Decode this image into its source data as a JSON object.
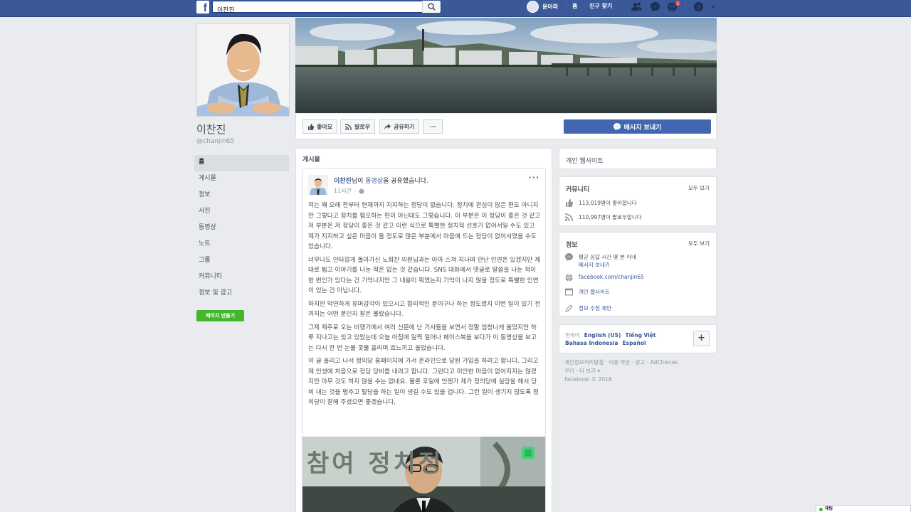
{
  "topbar": {
    "search_value": "이찬진",
    "user_name": "윤아라",
    "home": "홈",
    "find_friends": "친구 찾기",
    "notification_count": "1"
  },
  "profile": {
    "name": "이찬진",
    "handle": "@chanjin65"
  },
  "left_nav": [
    {
      "label": "홈"
    },
    {
      "label": "게시물"
    },
    {
      "label": "정보"
    },
    {
      "label": "사진"
    },
    {
      "label": "동영상"
    },
    {
      "label": "노트"
    },
    {
      "label": "그룹"
    },
    {
      "label": "커뮤니티"
    },
    {
      "label": "정보 및 광고"
    }
  ],
  "create_page_label": "페이지 만들기",
  "actions": {
    "like": "좋아요",
    "follow": "팔로우",
    "share": "공유하기",
    "more": "···",
    "message": "메시지 보내기"
  },
  "posts": {
    "title": "게시물",
    "post": {
      "author": "이찬진",
      "mid1": "님이 ",
      "link": "동영상",
      "mid2": "을 공유했습니다.",
      "time": "11시간",
      "paragraphs": [
        "저는 꽤 오래 전부터 현재까지 지지하는 정당이 없습니다. 정치에 관심이 많은 편도 아니지만 그렇다고 정치를 혐오하는 편이 아닌데도 그렇습니다. 이 부분은 이 정당이 좋은 것 같고 저 부분은 저 정당이 좋은 것 같고 이런 식으로 특별한 정치적 선호가 없어서일 수도 있고 제가 지지하고 싶은 마음이 들 정도로 많은 부분에서 마음에 드는 정당이 없어서였을 수도 있습니다.",
        "너무나도 안타깝게 돌아가신 노회찬 의원님과는 아마 스쳐 지나며 만난 인연은 있겠지만 제대로 뵙고 이야기를 나눈 적은 없는 것 같습니다. SNS 대화에서 댓글로 말씀을 나눈 적이 한 번인가 있다는 건 기억나지만 그 내용이 뭐였는지 기억이 나지 않을 정도로 특별한 인연이 있는 건 아닙니다.",
        "하지만 막연하게 유머감각이 있으시고 합리적인 분이구나 하는 정도였지 이번 일이 있기 전까지는 어떤 분인지 잘은 몰랐습니다.",
        "그제 제주로 오는 비행기에서 여러 신문에 난 기사들을 보면서 정말 엄청나게 울었지만 하루 지나고는 잊고 있었는데 오늘 아침에 일찍 일어나 페이스북을 보다가 이 동영상을 보고는 다시 한 번 눈물 콧물 흘리며 흐느끼고 울었습니다.",
        "이 글 올리고 나서 정의당 홈페이지에 가서 온라인으로 당원 가입을 하려고 합니다. 그리고 제 인생에 처음으로 정당 당비를 내려고 합니다. 그런다고 미안한 마음이 없어지지는 않겠지만 아무 것도 하지 않을 수는 없네요. 물론 후일에 언젠가 제가 정의당에 실망을 해서 당비 내는 것을 멈추고 탈당을 하는 일이 생길 수도 있을 겁니다. 그런 일이 생기지 않도록 정의당이 잘해 주셨으면 좋겠습니다."
      ],
      "video_text": "참여 정치정"
    }
  },
  "right": {
    "website_title": "개인 웹사이트",
    "community": {
      "title": "커뮤니티",
      "see_all": "모두 보기",
      "likes": "113,019명이 좋아합니다",
      "follows": "110,997명이 팔로우합니다"
    },
    "info": {
      "title": "정보",
      "see_all": "모두 보기",
      "response_line1": "평균 응답 시간 몇 분 이내",
      "response_line2": "메시지 보내기",
      "fb_url": "facebook.com/chanjin65",
      "website": "개인 웹사이트",
      "suggest_edit": "정보 수정 제안"
    },
    "languages": {
      "current": "한국어",
      "options": [
        "English (US)",
        "Tiếng Việt",
        "Bahasa Indonesia",
        "Español"
      ],
      "plus": "+"
    },
    "footer": {
      "line1": "개인정보처리방침 · 이용 약관 · 광고 · AdChoices",
      "line2": "쿠키 · 더 보기 ▾",
      "line3": "Facebook © 2018"
    }
  },
  "chat": {
    "label": "채팅"
  },
  "colors": {
    "brand": "#3b5998",
    "button_blue": "#4267b2",
    "green": "#42b72a",
    "link": "#385898",
    "background": "#e9ebee"
  }
}
